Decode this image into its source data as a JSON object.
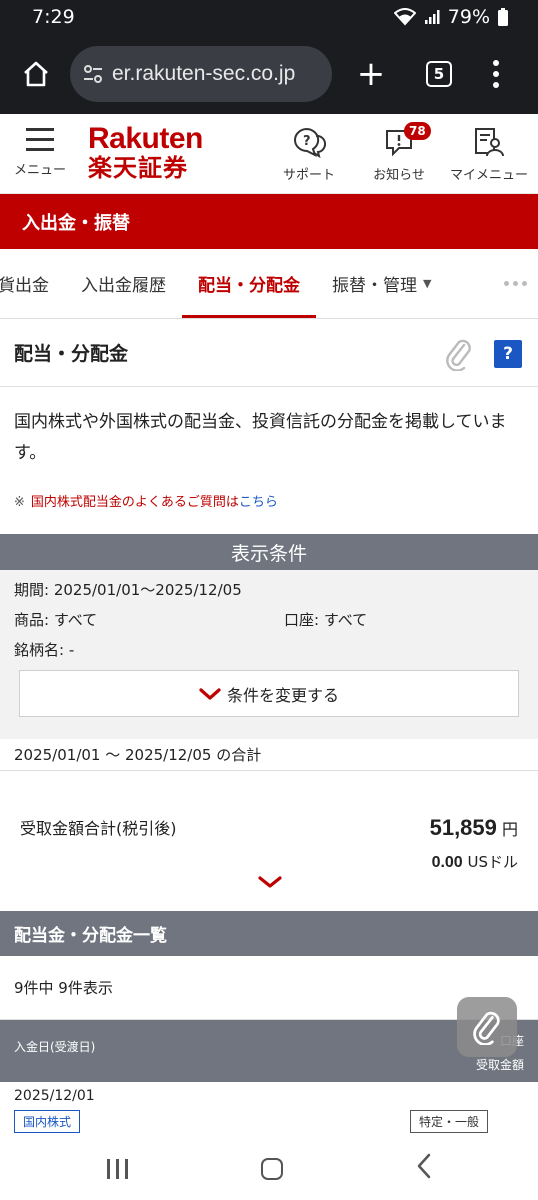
{
  "status_bar": {
    "time": "7:29",
    "battery": "79%"
  },
  "browser": {
    "url": "er.rakuten-sec.co.jp",
    "tab_count": "5"
  },
  "header": {
    "menu_label": "メニュー",
    "logo_en": "Rakuten",
    "logo_ja": "楽天証券",
    "support_label": "サポート",
    "notice_label": "お知らせ",
    "notice_badge": "78",
    "mymenu_label": "マイメニュー"
  },
  "section_title": "入出金・振替",
  "tabs": [
    {
      "label": "貨出金"
    },
    {
      "label": "入出金履歴"
    },
    {
      "label": "配当・分配金"
    },
    {
      "label": "振替・管理"
    }
  ],
  "page": {
    "title": "配当・分配金",
    "help_label": "?",
    "description": "国内株式や外国株式の配当金、投資信託の分配金を掲載しています。",
    "faq_mark": "※",
    "faq_text": "国内株式配当金のよくあるご質問は",
    "faq_link": "こちら"
  },
  "conditions": {
    "header": "表示条件",
    "period": "期間: 2025/01/01〜2025/12/05",
    "product": "商品: すべて",
    "account": "口座: すべて",
    "stock_name": "銘柄名: -",
    "change_button": "条件を変更する"
  },
  "totals": {
    "period_label": "2025/01/01 ～ 2025/12/05 の合計",
    "label": "受取金額合計(税引後)",
    "jpy_value": "51,859",
    "jpy_unit": "円",
    "usd_value": "0.00",
    "usd_unit": "USドル"
  },
  "list": {
    "header": "配当金・分配金一覧",
    "count_text": "9件中 9件表示",
    "col_date": "入金日(受渡日)",
    "col_account": "口座",
    "col_amount": "受取金額",
    "rows": [
      {
        "date": "2025/12/01",
        "product_tag": "国内株式",
        "account_tag": "特定・一般"
      }
    ]
  }
}
